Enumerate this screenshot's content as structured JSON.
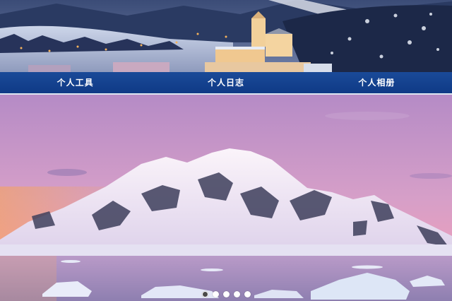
{
  "nav": {
    "items": [
      {
        "label": "个人工具"
      },
      {
        "label": "个人日志"
      },
      {
        "label": "个人相册"
      }
    ]
  },
  "carousel": {
    "slide_count": 5,
    "active_index": 0
  },
  "colors": {
    "nav_bg": "#0f3a86",
    "nav_text": "#ffffff",
    "dot_active": "#4a4a4a",
    "dot_inactive": "#ffffff"
  }
}
